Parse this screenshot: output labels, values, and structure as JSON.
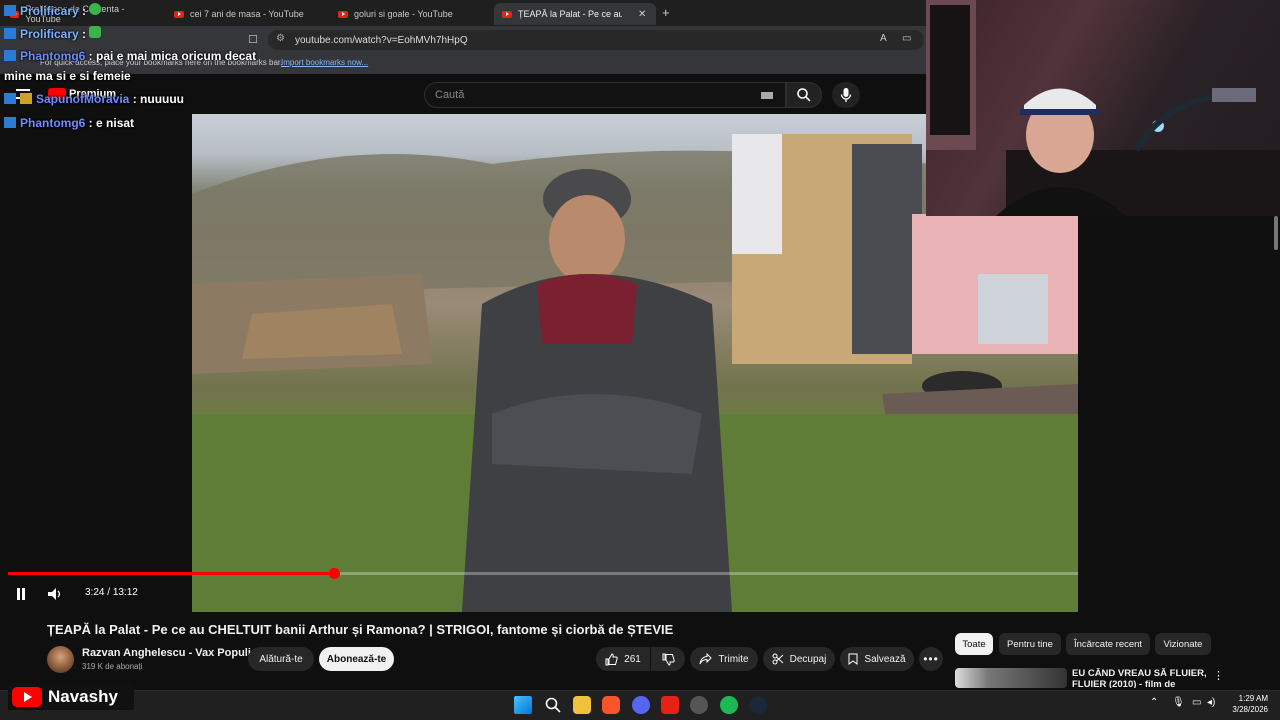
{
  "browser": {
    "tabs": [
      {
        "label": "Prolificary: de Contenta - YouTube"
      },
      {
        "label": "cei 7 ani de masa - YouTube"
      },
      {
        "label": "goluri si goale - YouTube"
      },
      {
        "label": "ȚEAPĂ la Palat - Pe ce au CHE"
      }
    ],
    "url": "youtube.com/watch?v=EohMVh7hHpQ",
    "bookmarks_message": "For quick access, place your bookmarks here on the bookmarks bar.",
    "bookmarks_link": "Import bookmarks now..."
  },
  "youtube": {
    "logo_text": "Premium",
    "search_placeholder": "Caută",
    "player": {
      "current_time": "3:24",
      "duration": "13:12",
      "progress_fraction": 0.258
    },
    "video_title": "ȚEAPĂ la Palat - Pe ce au CHELTUIT banii Arthur și Ramona? | STRIGOI, fantome și ciorbă de ȘTEVIE",
    "channel_name": "Razvan Anghelescu - Vax Populi",
    "subscribers": "319 K de abonați",
    "join_label": "Alătură-te",
    "subscribe_label": "Abonează-te",
    "likes": "261",
    "share_label": "Trimite",
    "clip_label": "Decupaj",
    "save_label": "Salvează",
    "filter_chips": [
      "Toate",
      "Pentru tine",
      "Încărcate recent",
      "Vizionate"
    ],
    "recommendation_title": "EU CÂND VREAU SĂ FLUIER, FLUIER (2010) - film de"
  },
  "chat": [
    {
      "user": "Prolificary",
      "text": ""
    },
    {
      "user": "Prolificary",
      "text": ""
    },
    {
      "user": "Phantomg6",
      "text": "pai e mai mica oricum decat"
    },
    {
      "user": "",
      "text": "mine ma si e si femeie"
    },
    {
      "user": "SapunofMoravia",
      "text": "nuuuuu"
    },
    {
      "user": "Phantomg6",
      "text": "e nisat"
    }
  ],
  "streamer_name": "Navashy",
  "taskbar": {
    "time": "1:29 AM",
    "date": "3/28/2026"
  },
  "colors": {
    "accent": "#ff0000",
    "chat_user": "#6e8bff"
  }
}
